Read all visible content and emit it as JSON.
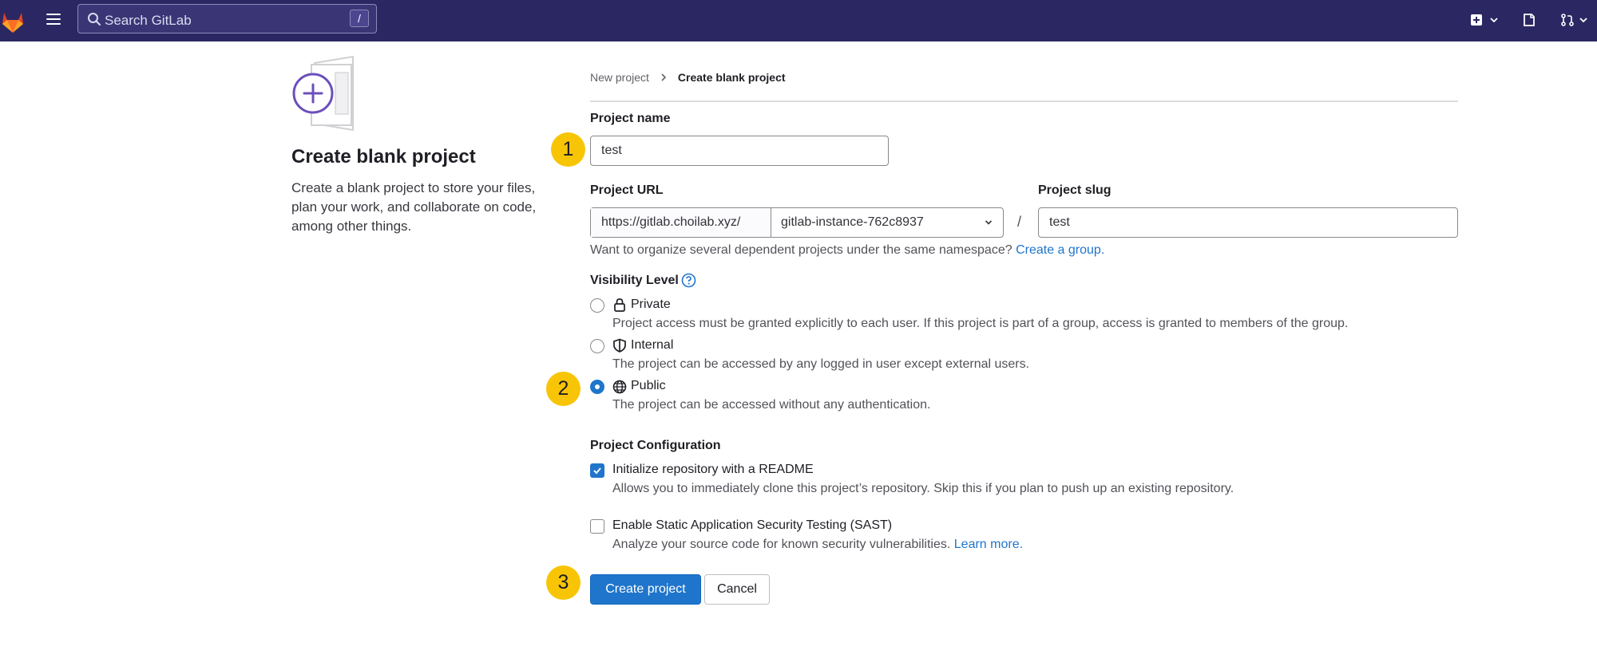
{
  "nav": {
    "search_placeholder": "Search GitLab",
    "search_shortcut": "/"
  },
  "left": {
    "title": "Create blank project",
    "description": "Create a blank project to store your files, plan your work, and collaborate on code, among other things."
  },
  "breadcrumb": {
    "parent": "New project",
    "current": "Create blank project"
  },
  "form": {
    "project_name_label": "Project name",
    "project_name_value": "test",
    "project_url_label": "Project URL",
    "url_prefix": "https://gitlab.choilab.xyz/",
    "namespace": "gitlab-instance-762c8937",
    "slash": "/",
    "project_slug_label": "Project slug",
    "project_slug_value": "test",
    "group_help_text": "Want to organize several dependent projects under the same namespace?",
    "group_help_link": "Create a group."
  },
  "visibility": {
    "label": "Visibility Level",
    "options": [
      {
        "label": "Private",
        "desc": "Project access must be granted explicitly to each user. If this project is part of a group, access is granted to members of the group.",
        "icon": "lock-icon",
        "selected": false
      },
      {
        "label": "Internal",
        "desc": "The project can be accessed by any logged in user except external users.",
        "icon": "shield-icon",
        "selected": false
      },
      {
        "label": "Public",
        "desc": "The project can be accessed without any authentication.",
        "icon": "globe-icon",
        "selected": true
      }
    ]
  },
  "config": {
    "label": "Project Configuration",
    "readme_label": "Initialize repository with a README",
    "readme_desc": "Allows you to immediately clone this project’s repository. Skip this if you plan to push up an existing repository.",
    "readme_checked": true,
    "sast_label": "Enable Static Application Security Testing (SAST)",
    "sast_desc": "Analyze your source code for known security vulnerabilities.",
    "sast_link": "Learn more.",
    "sast_checked": false
  },
  "buttons": {
    "create": "Create project",
    "cancel": "Cancel"
  },
  "annotations": {
    "step1": "1",
    "step2": "2",
    "step3": "3"
  },
  "colors": {
    "navbar": "#2b2763",
    "primary": "#1f75cb",
    "badge": "#f8c506"
  }
}
